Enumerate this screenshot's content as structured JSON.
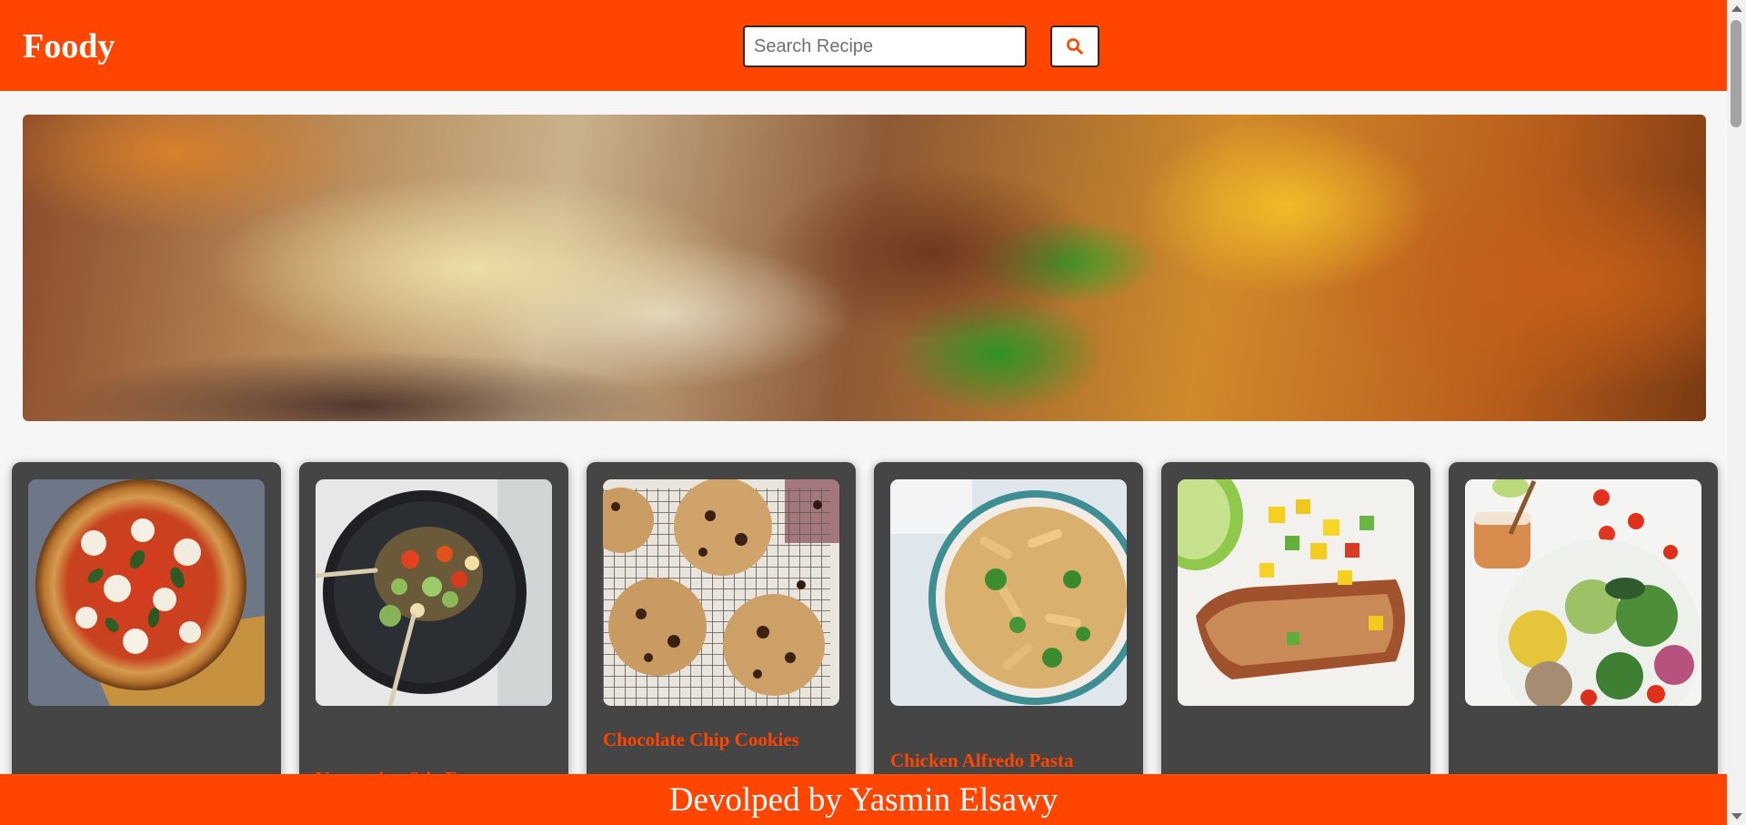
{
  "app": {
    "brand": "Foody"
  },
  "search": {
    "placeholder": "Search Recipe",
    "value": "",
    "button_icon": "search-icon"
  },
  "hero": {
    "image": "food-banner-image"
  },
  "recipes": [
    {
      "title": "",
      "image": "margherita-pizza-image"
    },
    {
      "title": "Vegetarian Stir-Fry",
      "image": "vegetarian-stir-fry-image"
    },
    {
      "title": "Chocolate Chip Cookies",
      "image": "chocolate-chip-cookies-image"
    },
    {
      "title": "Chicken Alfredo Pasta",
      "image": "chicken-alfredo-pasta-image"
    },
    {
      "title": "",
      "image": "grilled-chicken-mango-salsa-image"
    },
    {
      "title": "",
      "image": "quinoa-salad-bowl-image"
    }
  ],
  "footer": {
    "text": "Devolped by Yasmin Elsawy"
  },
  "colors": {
    "brand": "#ff4500",
    "card_background": "#454545",
    "page_background": "#f6f6f7",
    "text_on_brand": "#ffffff"
  }
}
